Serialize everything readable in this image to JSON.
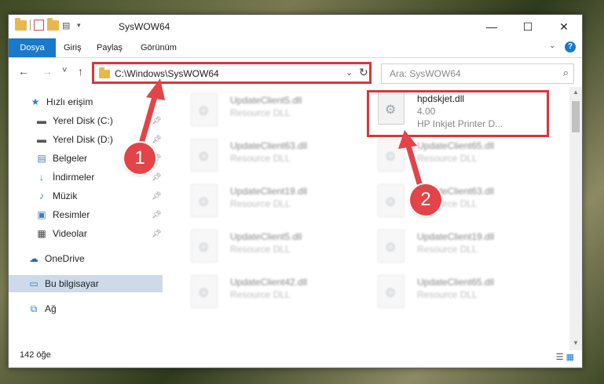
{
  "window": {
    "title": "SysWOW64",
    "controls": {
      "minimize": "—",
      "maximize": "☐",
      "close": "✕"
    }
  },
  "ribbon": {
    "tabs": [
      "Dosya",
      "Giriş",
      "Paylaş",
      "Görünüm"
    ],
    "active_tab": "Dosya",
    "accent_color": "#1979ca"
  },
  "navigation": {
    "back": "←",
    "forward": "→",
    "recent": "˅",
    "up": "↑",
    "address_path": "C:\\Windows\\SysWOW64",
    "search_placeholder": "Ara: SysWOW64"
  },
  "sidebar": {
    "items": [
      {
        "label": "Hızlı erişim",
        "icon": "star-icon"
      },
      {
        "label": "Yerel Disk (C:)",
        "icon": "drive-icon",
        "pinned": true
      },
      {
        "label": "Yerel Disk (D:)",
        "icon": "drive-icon",
        "pinned": true
      },
      {
        "label": "Belgeler",
        "icon": "documents-icon",
        "pinned": true
      },
      {
        "label": "İndirmeler",
        "icon": "download-icon",
        "pinned": true
      },
      {
        "label": "Müzik",
        "icon": "music-icon",
        "pinned": true
      },
      {
        "label": "Resimler",
        "icon": "pictures-icon",
        "pinned": true
      },
      {
        "label": "Videolar",
        "icon": "video-icon",
        "pinned": true
      },
      {
        "label": "OneDrive",
        "icon": "cloud-icon"
      },
      {
        "label": "Bu bilgisayar",
        "icon": "computer-icon",
        "selected": true
      },
      {
        "label": "Ağ",
        "icon": "network-icon"
      }
    ]
  },
  "files": {
    "highlighted": {
      "name": "hpdskjet.dll",
      "version": "4.00",
      "description": "HP Inkjet Printer D..."
    },
    "left_column": [
      {
        "name": "UpdateClient5.dll",
        "type": "Resource DLL"
      },
      {
        "name": "UpdateClient63.dll",
        "type": "Resource DLL"
      },
      {
        "name": "UpdateClient19.dll",
        "type": "Resource DLL"
      },
      {
        "name": "UpdateClient5.dll",
        "type": "Resource DLL"
      },
      {
        "name": "UpdateClient42.dll",
        "type": "Resource DLL"
      }
    ],
    "right_column": [
      {
        "name": "UpdateClient65.dll",
        "type": "Resource DLL"
      },
      {
        "name": "UpdateClient63.dll",
        "type": "Resource DLL"
      },
      {
        "name": "UpdateClient19.dll",
        "type": "Resource DLL"
      },
      {
        "name": "UpdateClient65.dll",
        "type": "Resource DLL"
      }
    ]
  },
  "status": {
    "item_count": "142 öğe"
  },
  "annotations": {
    "step1": "1",
    "step2": "2",
    "highlight_color": "#d9353a"
  }
}
